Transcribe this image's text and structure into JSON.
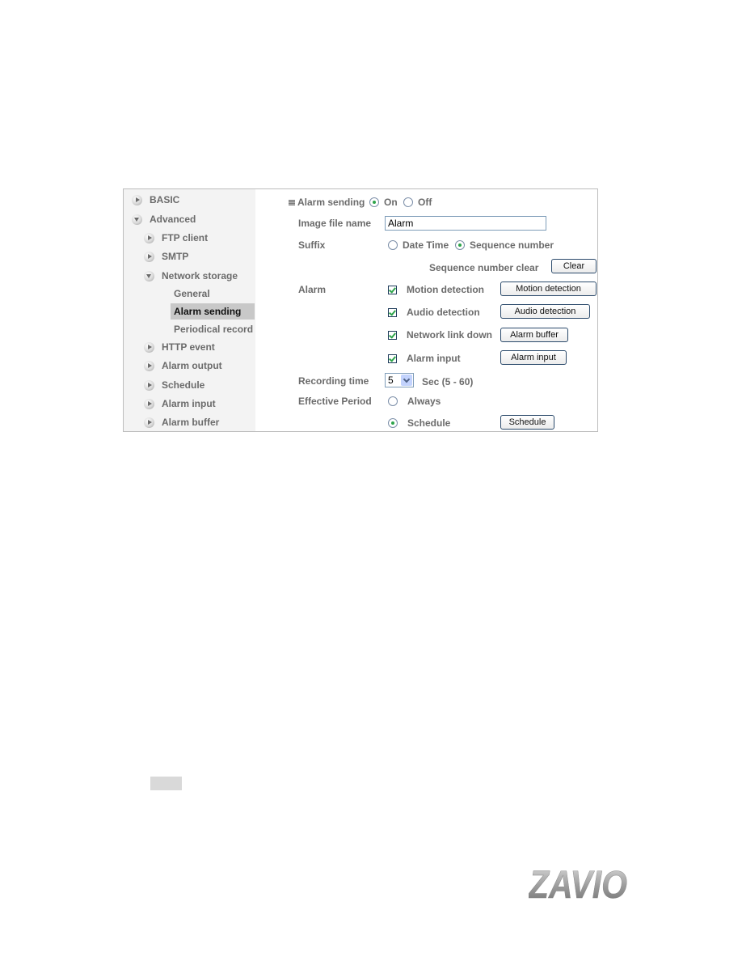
{
  "sidebar": {
    "items": [
      {
        "label": "BASIC",
        "icon": "arrow-right-icon"
      },
      {
        "label": "Advanced",
        "icon": "arrow-down-icon"
      },
      {
        "label": "FTP client",
        "icon": "arrow-right-icon"
      },
      {
        "label": "SMTP",
        "icon": "arrow-right-icon"
      },
      {
        "label": "Network storage",
        "icon": "arrow-down-icon"
      },
      {
        "label": "General"
      },
      {
        "label": "Alarm sending",
        "active": true
      },
      {
        "label": "Periodical record"
      },
      {
        "label": "HTTP event",
        "icon": "arrow-right-icon"
      },
      {
        "label": "Alarm output",
        "icon": "arrow-right-icon"
      },
      {
        "label": "Schedule",
        "icon": "arrow-right-icon"
      },
      {
        "label": "Alarm input",
        "icon": "arrow-right-icon"
      },
      {
        "label": "Alarm buffer",
        "icon": "arrow-right-icon"
      }
    ]
  },
  "form": {
    "section_title": "Alarm sending",
    "alarm_sending_on": "On",
    "alarm_sending_off": "Off",
    "alarm_sending_value": "On",
    "image_file_name_label": "Image file name",
    "image_file_name_value": "Alarm",
    "suffix_label": "Suffix",
    "suffix_options": [
      "Date Time",
      "Sequence number"
    ],
    "suffix_value": "Sequence number",
    "sequence_clear_label": "Sequence number clear",
    "clear_button": "Clear",
    "alarm_label": "Alarm",
    "alarms": [
      {
        "label": "Motion detection",
        "checked": true,
        "button": "Motion detection"
      },
      {
        "label": "Audio detection",
        "checked": true,
        "button": "Audio detection"
      },
      {
        "label": "Network link down",
        "checked": true,
        "button": "Alarm buffer"
      },
      {
        "label": "Alarm input",
        "checked": true,
        "button": "Alarm input"
      }
    ],
    "recording_time_label": "Recording time",
    "recording_time_value": "5",
    "recording_time_range": "Sec (5 - 60)",
    "effective_period_label": "Effective Period",
    "effective_always": "Always",
    "effective_schedule": "Schedule",
    "effective_value": "Schedule",
    "schedule_button": "Schedule"
  },
  "logo": {
    "text": "ZAVIO"
  }
}
